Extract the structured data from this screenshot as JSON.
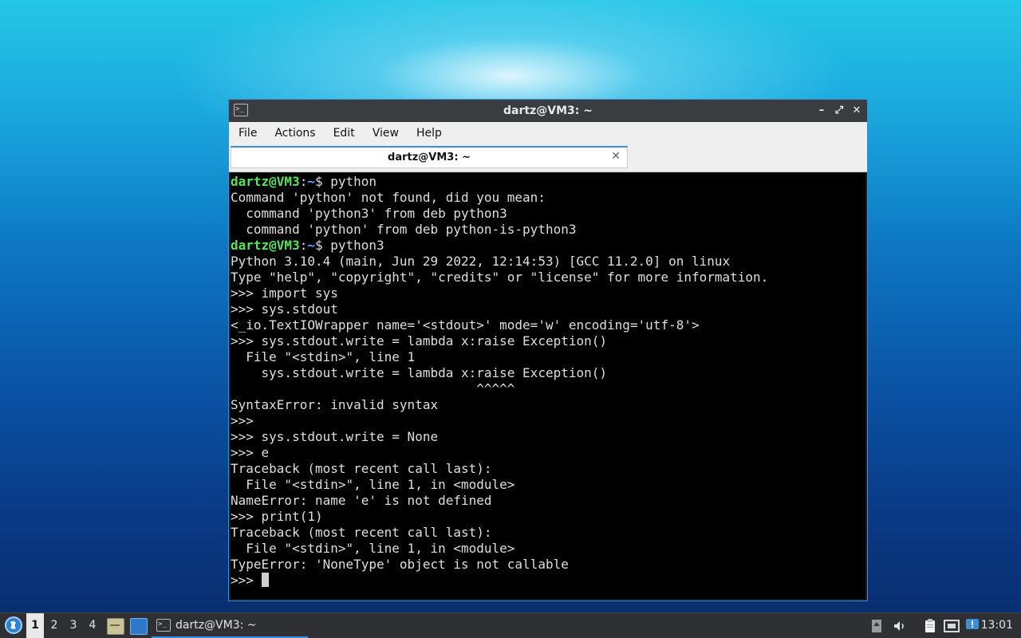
{
  "window": {
    "title": "dartz@VM3: ~",
    "controls": {
      "minimize": "–",
      "maximize": "⤢",
      "close": "✕"
    }
  },
  "menubar": {
    "items": [
      "File",
      "Actions",
      "Edit",
      "View",
      "Help"
    ]
  },
  "tab": {
    "label": "dartz@VM3: ~",
    "close": "✕"
  },
  "terminal": {
    "prompt_user": "dartz@VM3",
    "prompt_path": "~",
    "lines": [
      {
        "kind": "prompt",
        "text": " python"
      },
      {
        "kind": "out",
        "text": "Command 'python' not found, did you mean:"
      },
      {
        "kind": "out",
        "text": "  command 'python3' from deb python3"
      },
      {
        "kind": "out",
        "text": "  command 'python' from deb python-is-python3"
      },
      {
        "kind": "prompt",
        "text": " python3"
      },
      {
        "kind": "out",
        "text": "Python 3.10.4 (main, Jun 29 2022, 12:14:53) [GCC 11.2.0] on linux"
      },
      {
        "kind": "out",
        "text": "Type \"help\", \"copyright\", \"credits\" or \"license\" for more information."
      },
      {
        "kind": "out",
        "text": ">>> import sys"
      },
      {
        "kind": "out",
        "text": ">>> sys.stdout"
      },
      {
        "kind": "out",
        "text": "<_io.TextIOWrapper name='<stdout>' mode='w' encoding='utf-8'>"
      },
      {
        "kind": "out",
        "text": ">>> sys.stdout.write = lambda x:raise Exception()"
      },
      {
        "kind": "out",
        "text": "  File \"<stdin>\", line 1"
      },
      {
        "kind": "out",
        "text": "    sys.stdout.write = lambda x:raise Exception()"
      },
      {
        "kind": "out",
        "text": "                                ^^^^^"
      },
      {
        "kind": "out",
        "text": "SyntaxError: invalid syntax"
      },
      {
        "kind": "out",
        "text": ">>>"
      },
      {
        "kind": "out",
        "text": ">>> sys.stdout.write = None"
      },
      {
        "kind": "out",
        "text": ">>> e"
      },
      {
        "kind": "out",
        "text": "Traceback (most recent call last):"
      },
      {
        "kind": "out",
        "text": "  File \"<stdin>\", line 1, in <module>"
      },
      {
        "kind": "out",
        "text": "NameError: name 'e' is not defined"
      },
      {
        "kind": "out",
        "text": ">>> print(1)"
      },
      {
        "kind": "out",
        "text": "Traceback (most recent call last):"
      },
      {
        "kind": "out",
        "text": "  File \"<stdin>\", line 1, in <module>"
      },
      {
        "kind": "out",
        "text": "TypeError: 'NoneType' object is not callable"
      },
      {
        "kind": "input",
        "text": ">>> "
      }
    ]
  },
  "taskbar": {
    "workspaces": [
      "1",
      "2",
      "3",
      "4"
    ],
    "active_workspace": "1",
    "task_label": "dartz@VM3: ~",
    "clock": "13:01"
  },
  "colors": {
    "prompt_user": "#55e35a",
    "prompt_path": "#5fa8ff",
    "accent": "#3b8fd6"
  },
  "icons": [
    "terminal-icon",
    "start-menu-icon",
    "file-manager-icon",
    "show-desktop-icon",
    "volume-icon",
    "clipboard-icon",
    "network-icon",
    "update-notifier-icon"
  ]
}
